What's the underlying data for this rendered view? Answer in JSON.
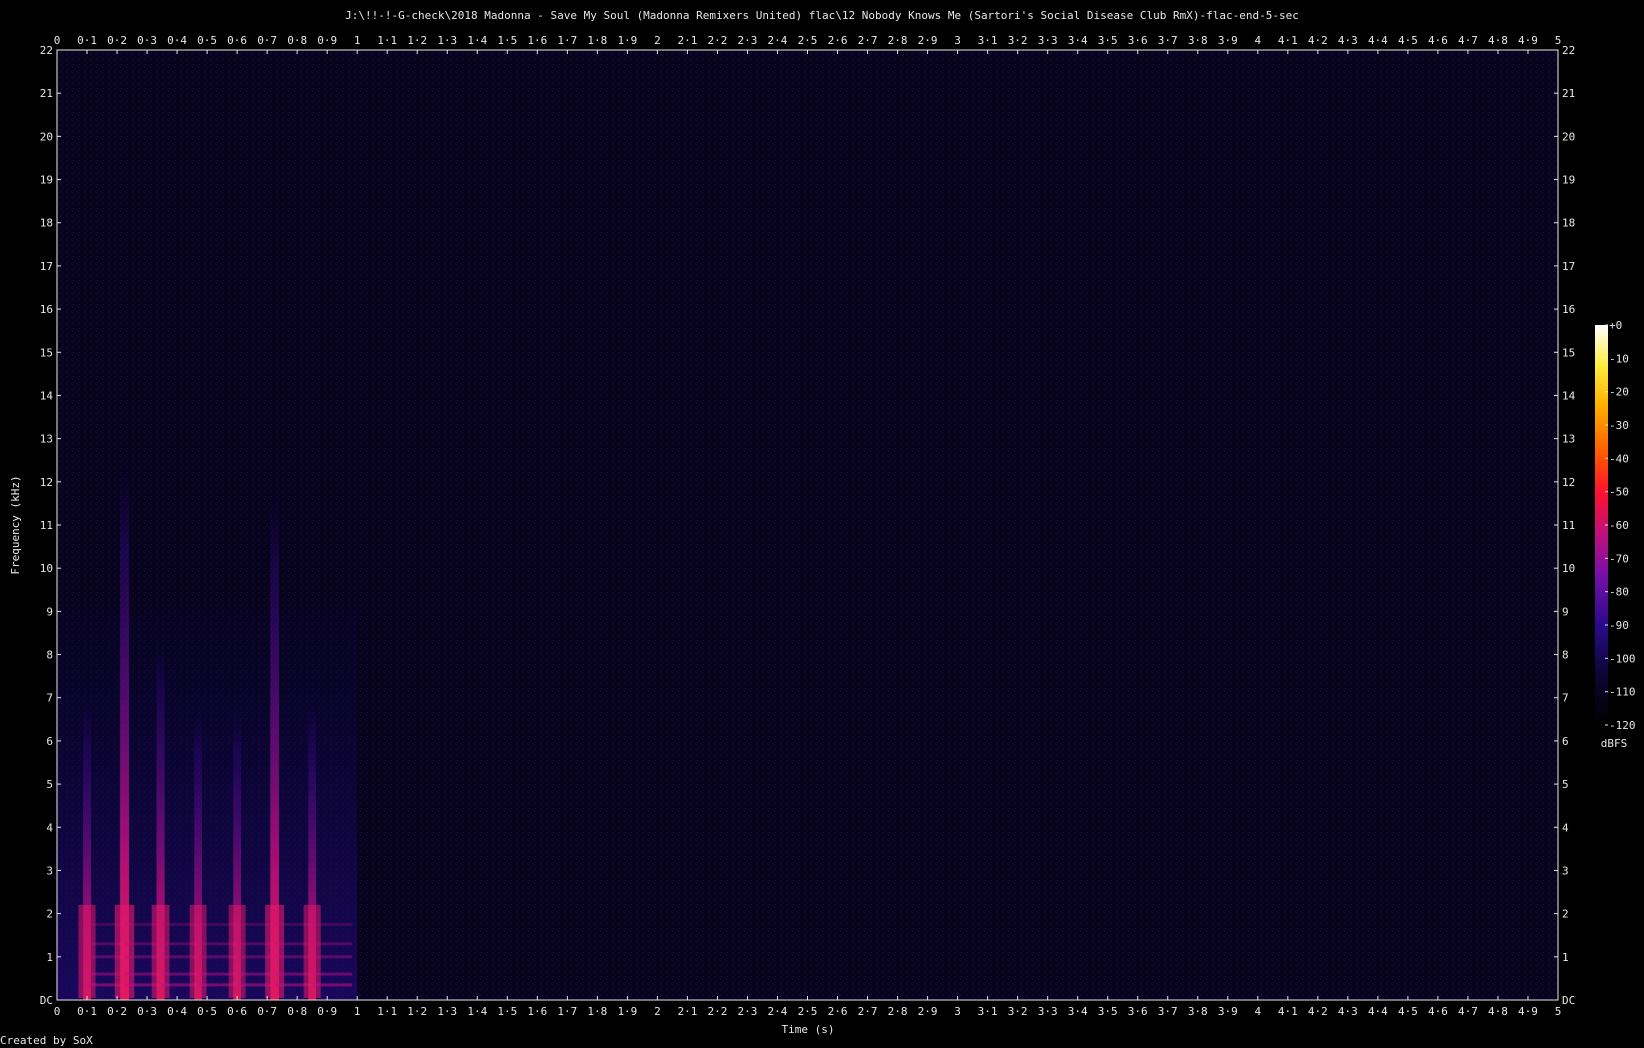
{
  "chart_data": {
    "type": "heatmap",
    "title": "J:\\!!-!-G-check\\2018 Madonna - Save My Soul (Madonna Remixers United) flac\\12 Nobody Knows Me (Sartori's Social Disease Club RmX)-flac-end-5-sec",
    "xlabel": "Time (s)",
    "ylabel": "Frequency (kHz)",
    "xlim": [
      0,
      5
    ],
    "ylim": [
      0,
      22
    ],
    "x_ticks": [
      "0",
      "0·1",
      "0·2",
      "0·3",
      "0·4",
      "0·5",
      "0·6",
      "0·7",
      "0·8",
      "0·9",
      "1",
      "1·1",
      "1·2",
      "1·3",
      "1·4",
      "1·5",
      "1·6",
      "1·7",
      "1·8",
      "1·9",
      "2",
      "2·1",
      "2·2",
      "2·3",
      "2·4",
      "2·5",
      "2·6",
      "2·7",
      "2·8",
      "2·9",
      "3",
      "3·1",
      "3·2",
      "3·3",
      "3·4",
      "3·5",
      "3·6",
      "3·7",
      "3·8",
      "3·9",
      "4",
      "4·1",
      "4·2",
      "4·3",
      "4·4",
      "4·5",
      "4·6",
      "4·7",
      "4·8",
      "4·9",
      "5"
    ],
    "y_ticks": [
      "DC",
      "1",
      "2",
      "3",
      "4",
      "5",
      "6",
      "7",
      "8",
      "9",
      "10",
      "11",
      "12",
      "13",
      "14",
      "15",
      "16",
      "17",
      "18",
      "19",
      "20",
      "21",
      "22"
    ],
    "colorbar": {
      "label": "dBFS",
      "ticks": [
        "+0",
        "-10",
        "-20",
        "-30",
        "-40",
        "-50",
        "-60",
        "-70",
        "-80",
        "-90",
        "-100",
        "-110",
        "-120"
      ],
      "range": [
        -120,
        0
      ]
    },
    "transients": [
      {
        "t": 0.1,
        "top_khz": 7.0,
        "peak_dbfs": -78
      },
      {
        "t": 0.225,
        "top_khz": 12.5,
        "peak_dbfs": -62
      },
      {
        "t": 0.345,
        "top_khz": 8.4,
        "peak_dbfs": -74
      },
      {
        "t": 0.47,
        "top_khz": 6.8,
        "peak_dbfs": -80
      },
      {
        "t": 0.6,
        "top_khz": 6.8,
        "peak_dbfs": -80
      },
      {
        "t": 0.725,
        "top_khz": 11.8,
        "peak_dbfs": -66
      },
      {
        "t": 0.85,
        "top_khz": 7.0,
        "peak_dbfs": -78
      }
    ],
    "decay_end_s": 1.0,
    "noise_floor_dbfs": -112
  },
  "footer": "Created by SoX"
}
